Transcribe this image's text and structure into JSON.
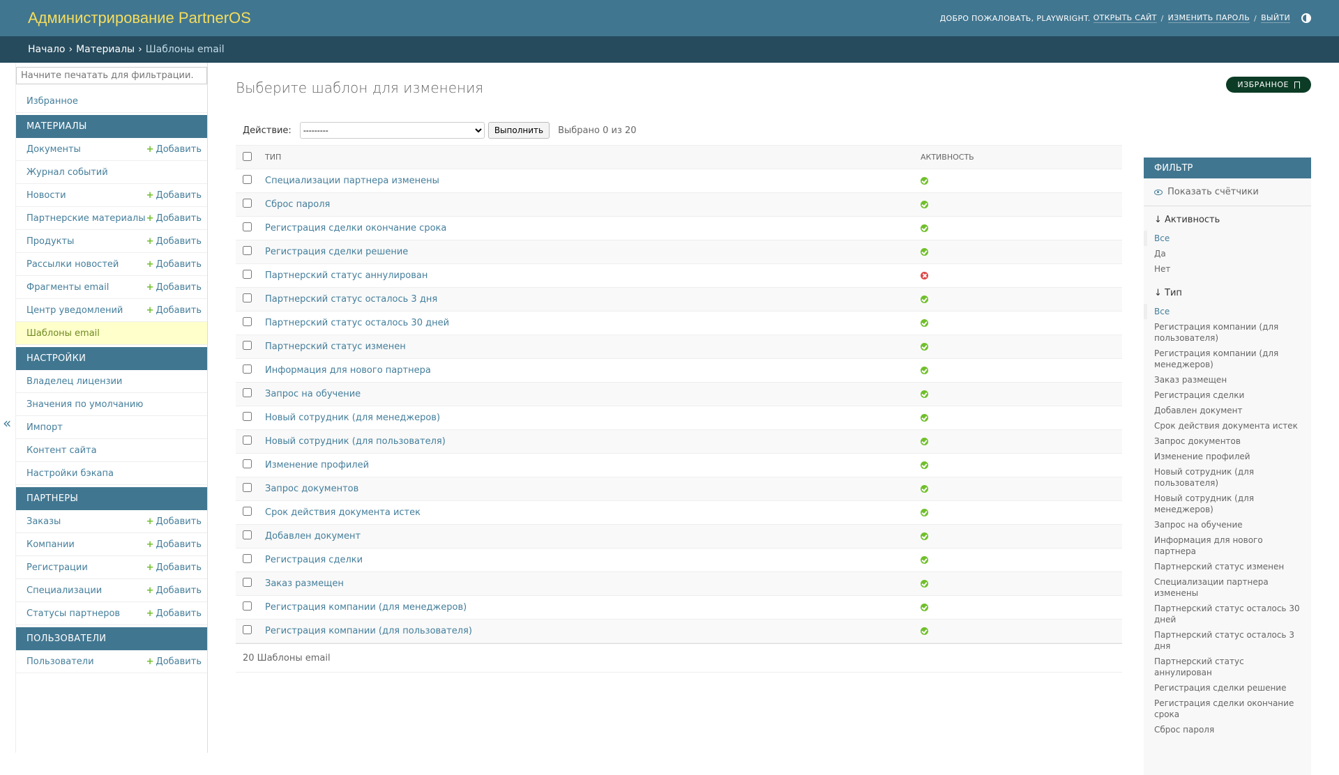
{
  "header": {
    "site_name": "Администрирование PartnerOS",
    "welcome": "Добро пожаловать,",
    "username": "Playwright.",
    "view_site": "Открыть сайт",
    "change_password": "Изменить пароль",
    "logout": "Выйти",
    "sep": "/"
  },
  "breadcrumbs": {
    "home": "Начало",
    "app": "Материалы",
    "current": "Шаблоны email",
    "arrow": "›"
  },
  "nav": {
    "filter_placeholder": "Начните печатать для фильтрации...",
    "favorites": "Избранное",
    "add_label": "Добавить",
    "plus": "+",
    "collapse": "«",
    "sections": [
      {
        "title": "Материалы",
        "items": [
          {
            "label": "Документы",
            "add": true
          },
          {
            "label": "Журнал событий",
            "add": false
          },
          {
            "label": "Новости",
            "add": true
          },
          {
            "label": "Партнерские материалы",
            "add": true
          },
          {
            "label": "Продукты",
            "add": true
          },
          {
            "label": "Рассылки новостей",
            "add": true
          },
          {
            "label": "Фрагменты email",
            "add": true
          },
          {
            "label": "Центр уведомлений",
            "add": true
          },
          {
            "label": "Шаблоны email",
            "add": false,
            "current": true
          }
        ]
      },
      {
        "title": "Настройки",
        "items": [
          {
            "label": "Владелец лицензии",
            "add": false
          },
          {
            "label": "Значения по умолчанию",
            "add": false
          },
          {
            "label": "Импорт",
            "add": false
          },
          {
            "label": "Контент сайта",
            "add": false
          },
          {
            "label": "Настройки бэкапа",
            "add": false
          }
        ]
      },
      {
        "title": "Партнеры",
        "items": [
          {
            "label": "Заказы",
            "add": true
          },
          {
            "label": "Компании",
            "add": true
          },
          {
            "label": "Регистрации",
            "add": true
          },
          {
            "label": "Специализации",
            "add": true
          },
          {
            "label": "Статусы партнеров",
            "add": true
          }
        ]
      },
      {
        "title": "Пользователи",
        "items": [
          {
            "label": "Пользователи",
            "add": true
          }
        ]
      }
    ]
  },
  "content": {
    "title": "Выберите шаблон для изменения",
    "favorites_button": "ИЗБРАННОЕ",
    "action_label": "Действие:",
    "action_selected": "---------",
    "run_button": "Выполнить",
    "counter": "Выбрано 0 из 20",
    "columns": {
      "type": "Тип",
      "active": "Активность"
    },
    "rows": [
      {
        "type": "Специализации партнера изменены",
        "active": true
      },
      {
        "type": "Сброс пароля",
        "active": true
      },
      {
        "type": "Регистрация сделки окончание срока",
        "active": true
      },
      {
        "type": "Регистрация сделки решение",
        "active": true
      },
      {
        "type": "Партнерский статус аннулирован",
        "active": false
      },
      {
        "type": "Партнерский статус осталось 3 дня",
        "active": true
      },
      {
        "type": "Партнерский статус осталось 30 дней",
        "active": true
      },
      {
        "type": "Партнерский статус изменен",
        "active": true
      },
      {
        "type": "Информация для нового партнера",
        "active": true
      },
      {
        "type": "Запрос на обучение",
        "active": true
      },
      {
        "type": "Новый сотрудник (для менеджеров)",
        "active": true
      },
      {
        "type": "Новый сотрудник (для пользователя)",
        "active": true
      },
      {
        "type": "Изменение профилей",
        "active": true
      },
      {
        "type": "Запрос документов",
        "active": true
      },
      {
        "type": "Срок действия документа истек",
        "active": true
      },
      {
        "type": "Добавлен документ",
        "active": true
      },
      {
        "type": "Регистрация сделки",
        "active": true
      },
      {
        "type": "Заказ размещен",
        "active": true
      },
      {
        "type": "Регистрация компании (для менеджеров)",
        "active": true
      },
      {
        "type": "Регистрация компании (для пользователя)",
        "active": true
      }
    ],
    "paginator": "20 Шаблоны email"
  },
  "filter": {
    "title": "Фильтр",
    "show_counts": "Показать счётчики",
    "groups": [
      {
        "title": "↓ Активность",
        "options": [
          {
            "label": "Все",
            "selected": true
          },
          {
            "label": "Да",
            "selected": false
          },
          {
            "label": "Нет",
            "selected": false
          }
        ]
      },
      {
        "title": "↓ Тип",
        "options": [
          {
            "label": "Все",
            "selected": true
          },
          {
            "label": "Регистрация компании (для пользователя)",
            "selected": false
          },
          {
            "label": "Регистрация компании (для менеджеров)",
            "selected": false
          },
          {
            "label": "Заказ размещен",
            "selected": false
          },
          {
            "label": "Регистрация сделки",
            "selected": false
          },
          {
            "label": "Добавлен документ",
            "selected": false
          },
          {
            "label": "Срок действия документа истек",
            "selected": false
          },
          {
            "label": "Запрос документов",
            "selected": false
          },
          {
            "label": "Изменение профилей",
            "selected": false
          },
          {
            "label": "Новый сотрудник (для пользователя)",
            "selected": false
          },
          {
            "label": "Новый сотрудник (для менеджеров)",
            "selected": false
          },
          {
            "label": "Запрос на обучение",
            "selected": false
          },
          {
            "label": "Информация для нового партнера",
            "selected": false
          },
          {
            "label": "Партнерский статус изменен",
            "selected": false
          },
          {
            "label": "Специализации партнера изменены",
            "selected": false
          },
          {
            "label": "Партнерский статус осталось 30 дней",
            "selected": false
          },
          {
            "label": "Партнерский статус осталось 3 дня",
            "selected": false
          },
          {
            "label": "Партнерский статус аннулирован",
            "selected": false
          },
          {
            "label": "Регистрация сделки решение",
            "selected": false
          },
          {
            "label": "Регистрация сделки окончание срока",
            "selected": false
          },
          {
            "label": "Сброс пароля",
            "selected": false
          }
        ]
      }
    ]
  },
  "colors": {
    "header_bg": "#417690",
    "breadcrumb_bg": "#264b5d",
    "site_name": "#f5dd5d",
    "link": "#447e9b",
    "add_plus": "#70bf2b",
    "icon_yes": "#70bf2b",
    "icon_no": "#dd4646",
    "current_row": "#ffffcc",
    "favorites_bg": "#0c3c26"
  }
}
